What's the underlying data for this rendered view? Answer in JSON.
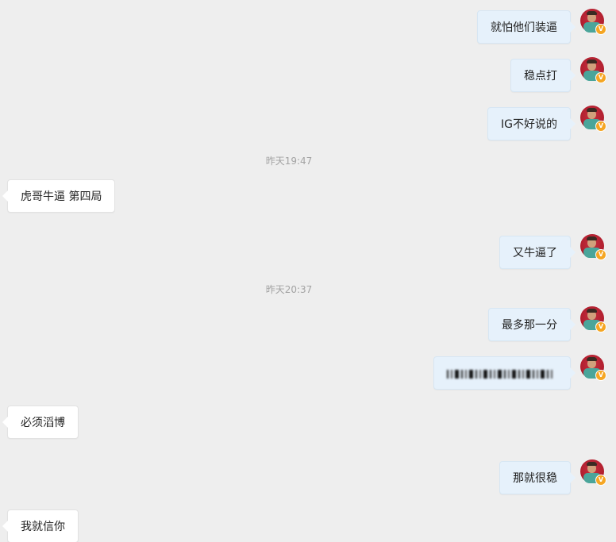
{
  "messages": [
    {
      "side": "out",
      "text": "就怕他们装逼"
    },
    {
      "side": "out",
      "text": "稳点打"
    },
    {
      "side": "out",
      "text": "IG不好说的"
    },
    {
      "type": "time",
      "text": "昨天19:47"
    },
    {
      "side": "in",
      "text": "虎哥牛逼 第四局"
    },
    {
      "side": "out",
      "text": "又牛逼了"
    },
    {
      "type": "time",
      "text": "昨天20:37"
    },
    {
      "side": "out",
      "text": "最多那一分"
    },
    {
      "side": "out",
      "text": "",
      "redacted": true
    },
    {
      "side": "in",
      "text": "必须滔博"
    },
    {
      "side": "out",
      "text": "那就很稳"
    },
    {
      "side": "in",
      "text": "我就信你"
    }
  ],
  "avatar": {
    "badge_icon": "v-verified-icon",
    "badge_text": "V"
  },
  "colors": {
    "background": "#eeeeee",
    "outgoing_bubble": "#e6f1fb",
    "incoming_bubble": "#ffffff",
    "timestamp": "#a3a3a3",
    "badge": "#f5a623"
  }
}
